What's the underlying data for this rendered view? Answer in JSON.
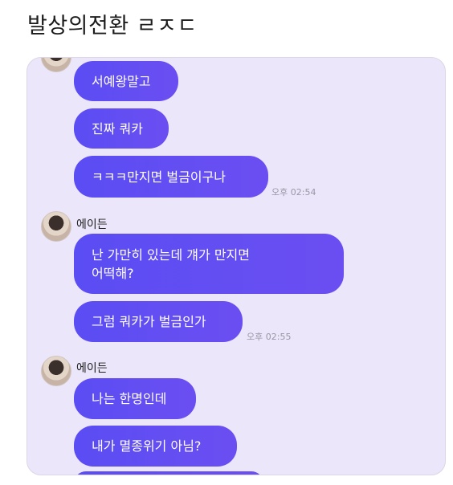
{
  "post": {
    "title": "발상의전환 ㄹㅈㄷ"
  },
  "chat": {
    "messages_group1": [
      {
        "text": "서예왕말고"
      },
      {
        "text": "진짜 쿼카"
      },
      {
        "text": "ㅋㅋㅋ만지면 벌금이구나"
      }
    ],
    "time1": "오후 02:54",
    "sender2": "에이든",
    "messages_group2": [
      {
        "text": "난 가만히 있는데 걔가 만지면\n어떡해?"
      },
      {
        "text": "그럼 쿼카가 벌금인가"
      }
    ],
    "time2": "오후 02:55",
    "sender3": "에이든",
    "messages_group3": [
      {
        "text": "나는 한명인데"
      },
      {
        "text": "내가 멸종위기 아님?"
      }
    ]
  },
  "colors": {
    "bubble": "#5a4df3",
    "card_bg": "#ece6fa"
  }
}
